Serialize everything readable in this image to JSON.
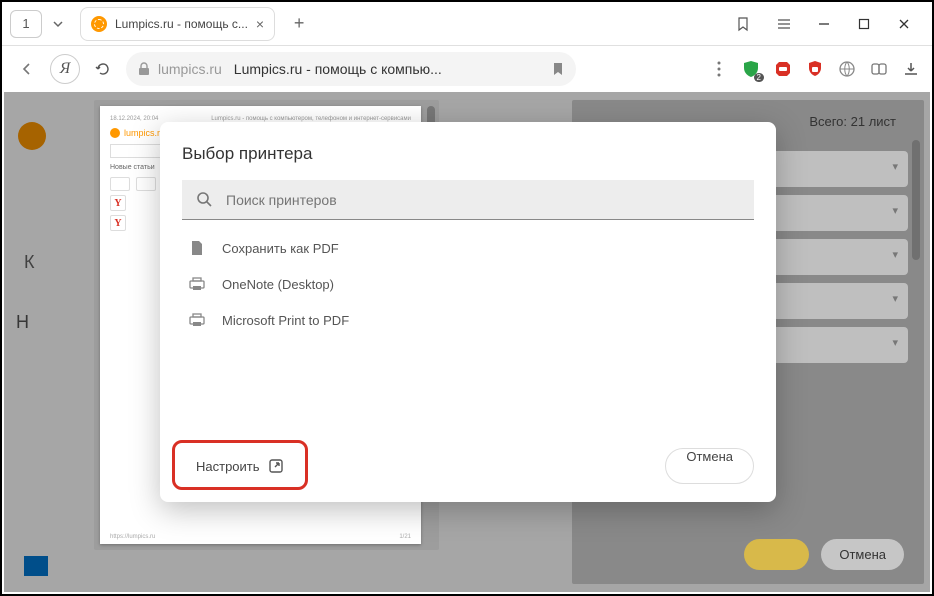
{
  "window": {
    "tab_count": "1",
    "tab_title": "Lumpics.ru - помощь с..."
  },
  "address": {
    "domain": "lumpics.ru",
    "title": "Lumpics.ru - помощь с компью...",
    "shield_badge": "2"
  },
  "print_panel": {
    "total": "Всего: 21 лист",
    "cancel": "Отмена"
  },
  "modal": {
    "title": "Выбор принтера",
    "search_placeholder": "Поиск принтеров",
    "printers": [
      "Сохранить как PDF",
      "OneNote (Desktop)",
      "Microsoft Print to PDF"
    ],
    "configure": "Настроить",
    "cancel": "Отмена"
  },
  "doc": {
    "timestamp": "18.12.2024, 20:04",
    "header": "Lumpics.ru - помощь с компьютером, телефоном и интернет-сервисами",
    "brand": "lumpics.ru",
    "section": "Новые статьи",
    "footer_url": "https://lumpics.ru",
    "page": "1/21"
  },
  "bg": {
    "k": "К",
    "h": "Н"
  }
}
